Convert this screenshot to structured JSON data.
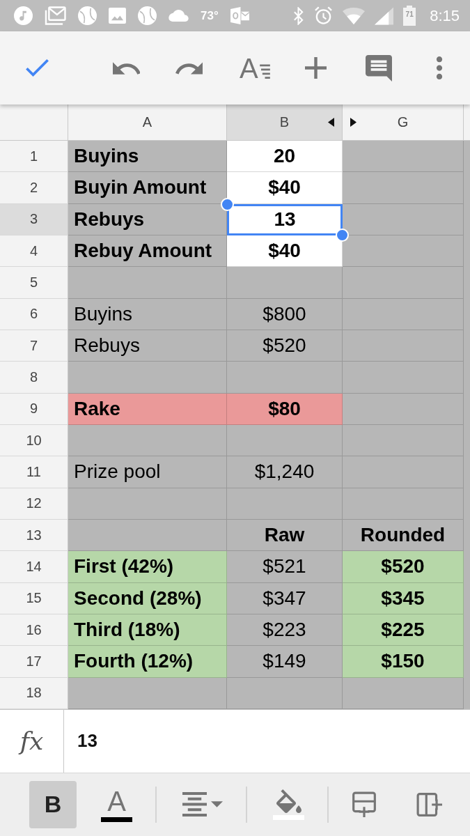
{
  "status_bar": {
    "temperature": "73°",
    "battery": "71",
    "time": "8:15"
  },
  "toolbar": {
    "buttons": [
      {
        "kind": "done"
      },
      {
        "kind": "undo"
      },
      {
        "kind": "redo"
      },
      {
        "kind": "text_format",
        "glyph": "A"
      },
      {
        "kind": "insert"
      },
      {
        "kind": "comment"
      },
      {
        "kind": "more"
      }
    ]
  },
  "sheet": {
    "columns": [
      {
        "label": "A",
        "selected": false,
        "centered": false,
        "hidden_before": false,
        "hidden_after": false
      },
      {
        "label": "B",
        "selected": true,
        "centered": true,
        "hidden_before": false,
        "hidden_after": true
      },
      {
        "label": "G",
        "selected": false,
        "centered": true,
        "hidden_before": true,
        "hidden_after": false
      }
    ],
    "rows": [
      {
        "number": "1",
        "selected": false,
        "cells": [
          {
            "text": "Buyins",
            "bold": true,
            "color": "#b7b7b7",
            "selected": false
          },
          {
            "text": "20",
            "bold": true,
            "color": "#ffffff",
            "selected": false
          },
          {
            "color": "#b7b7b7",
            "selected": false
          }
        ]
      },
      {
        "number": "2",
        "selected": false,
        "cells": [
          {
            "text": "Buyin Amount",
            "bold": true,
            "color": "#b7b7b7",
            "selected": false
          },
          {
            "text": "$40",
            "bold": true,
            "color": "#ffffff",
            "selected": false
          },
          {
            "color": "#b7b7b7",
            "selected": false
          }
        ]
      },
      {
        "number": "3",
        "selected": true,
        "cells": [
          {
            "text": "Rebuys",
            "bold": true,
            "color": "#b7b7b7",
            "selected": false
          },
          {
            "text": "13",
            "bold": true,
            "color": "#ffffff",
            "selected": true
          },
          {
            "color": "#b7b7b7",
            "selected": false
          }
        ]
      },
      {
        "number": "4",
        "selected": false,
        "cells": [
          {
            "text": "Rebuy Amount",
            "bold": true,
            "color": "#b7b7b7",
            "selected": false
          },
          {
            "text": "$40",
            "bold": true,
            "color": "#ffffff",
            "selected": false
          },
          {
            "color": "#b7b7b7",
            "selected": false
          }
        ]
      },
      {
        "number": "5",
        "selected": false,
        "cells": [
          {
            "color": "#b7b7b7",
            "selected": false
          },
          {
            "color": "#b7b7b7",
            "selected": false
          },
          {
            "color": "#b7b7b7",
            "selected": false
          }
        ]
      },
      {
        "number": "6",
        "selected": false,
        "cells": [
          {
            "text": "Buyins",
            "bold": false,
            "color": "#b7b7b7",
            "selected": false
          },
          {
            "text": "$800",
            "bold": false,
            "color": "#b7b7b7",
            "selected": false
          },
          {
            "color": "#b7b7b7",
            "selected": false
          }
        ]
      },
      {
        "number": "7",
        "selected": false,
        "cells": [
          {
            "text": "Rebuys",
            "bold": false,
            "color": "#b7b7b7",
            "selected": false
          },
          {
            "text": "$520",
            "bold": false,
            "color": "#b7b7b7",
            "selected": false
          },
          {
            "color": "#b7b7b7",
            "selected": false
          }
        ]
      },
      {
        "number": "8",
        "selected": false,
        "cells": [
          {
            "color": "#b7b7b7",
            "selected": false
          },
          {
            "color": "#b7b7b7",
            "selected": false
          },
          {
            "color": "#b7b7b7",
            "selected": false
          }
        ]
      },
      {
        "number": "9",
        "selected": false,
        "cells": [
          {
            "text": "Rake",
            "bold": true,
            "color": "#ea9999",
            "selected": false
          },
          {
            "text": "$80",
            "bold": true,
            "color": "#ea9999",
            "selected": false
          },
          {
            "color": "#b7b7b7",
            "selected": false
          }
        ]
      },
      {
        "number": "10",
        "selected": false,
        "cells": [
          {
            "color": "#b7b7b7",
            "selected": false
          },
          {
            "color": "#b7b7b7",
            "selected": false
          },
          {
            "color": "#b7b7b7",
            "selected": false
          }
        ]
      },
      {
        "number": "11",
        "selected": false,
        "cells": [
          {
            "text": "Prize pool",
            "bold": false,
            "color": "#b7b7b7",
            "selected": false
          },
          {
            "text": "$1,240",
            "bold": false,
            "color": "#b7b7b7",
            "selected": false
          },
          {
            "color": "#b7b7b7",
            "selected": false
          }
        ]
      },
      {
        "number": "12",
        "selected": false,
        "cells": [
          {
            "color": "#b7b7b7",
            "selected": false
          },
          {
            "color": "#b7b7b7",
            "selected": false
          },
          {
            "color": "#b7b7b7",
            "selected": false
          }
        ]
      },
      {
        "number": "13",
        "selected": false,
        "cells": [
          {
            "color": "#b7b7b7",
            "selected": false
          },
          {
            "text": "Raw",
            "bold": true,
            "color": "#b7b7b7",
            "selected": false
          },
          {
            "text": "Rounded",
            "bold": true,
            "color": "#b7b7b7",
            "selected": false
          }
        ]
      },
      {
        "number": "14",
        "selected": false,
        "cells": [
          {
            "text": "First (42%)",
            "bold": true,
            "color": "#b6d7a8",
            "selected": false
          },
          {
            "text": "$521",
            "bold": false,
            "color": "#b7b7b7",
            "selected": false
          },
          {
            "text": "$520",
            "bold": true,
            "color": "#b6d7a8",
            "selected": false
          }
        ]
      },
      {
        "number": "15",
        "selected": false,
        "cells": [
          {
            "text": "Second (28%)",
            "bold": true,
            "color": "#b6d7a8",
            "selected": false
          },
          {
            "text": "$347",
            "bold": false,
            "color": "#b7b7b7",
            "selected": false
          },
          {
            "text": "$345",
            "bold": true,
            "color": "#b6d7a8",
            "selected": false
          }
        ]
      },
      {
        "number": "16",
        "selected": false,
        "cells": [
          {
            "text": "Third (18%)",
            "bold": true,
            "color": "#b6d7a8",
            "selected": false
          },
          {
            "text": "$223",
            "bold": false,
            "color": "#b7b7b7",
            "selected": false
          },
          {
            "text": "$225",
            "bold": true,
            "color": "#b6d7a8",
            "selected": false
          }
        ]
      },
      {
        "number": "17",
        "selected": false,
        "cells": [
          {
            "text": "Fourth (12%)",
            "bold": true,
            "color": "#b6d7a8",
            "selected": false
          },
          {
            "text": "$149",
            "bold": false,
            "color": "#b7b7b7",
            "selected": false
          },
          {
            "text": "$150",
            "bold": true,
            "color": "#b6d7a8",
            "selected": false
          }
        ]
      },
      {
        "number": "18",
        "selected": false,
        "cells": [
          {
            "color": "#b7b7b7",
            "selected": false
          },
          {
            "color": "#b7b7b7",
            "selected": false
          },
          {
            "color": "#b7b7b7",
            "selected": false
          }
        ]
      }
    ]
  },
  "formula_bar": {
    "label": "fx",
    "value": "13"
  },
  "format_bar": {
    "groups": [
      [
        {
          "kind": "bold",
          "glyph": "B",
          "selected": true
        },
        {
          "kind": "text_color",
          "glyph": "A",
          "color": "#000000"
        }
      ],
      [
        {
          "kind": "align"
        }
      ],
      [
        {
          "kind": "fill_color",
          "color": "#ffffff"
        }
      ],
      [
        {
          "kind": "insert_row"
        },
        {
          "kind": "insert_column"
        }
      ]
    ]
  }
}
